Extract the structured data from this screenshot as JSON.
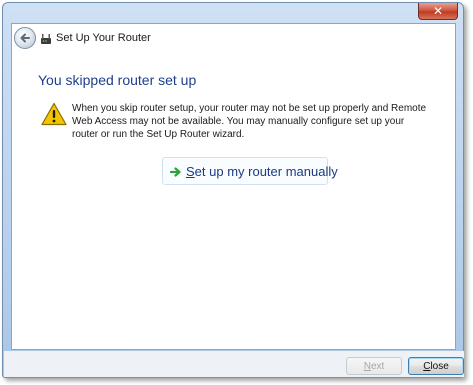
{
  "window": {
    "close_glyph": "✕",
    "header_title": "Set Up Your Router"
  },
  "main": {
    "heading": "You skipped router set up",
    "message": "When you skip router setup, your router may not be set up properly and Remote Web Access may not be available. You may manually configure set up your router or run the Set Up Router wizard.",
    "command_link": {
      "mnemonic": "S",
      "rest": "et up my router manually"
    }
  },
  "footer": {
    "next": {
      "mnemonic": "N",
      "rest": "ext",
      "enabled": false
    },
    "close": {
      "mnemonic": "C",
      "rest": "lose",
      "enabled": true
    }
  },
  "icons": {
    "back": "back-arrow-icon",
    "app": "router-icon",
    "warning": "warning-icon",
    "link_arrow": "green-arrow-icon"
  },
  "colors": {
    "heading": "#1e3f8f",
    "link": "#1c3a80",
    "warning_fill": "#f5c400",
    "arrow": "#2ea33a"
  }
}
